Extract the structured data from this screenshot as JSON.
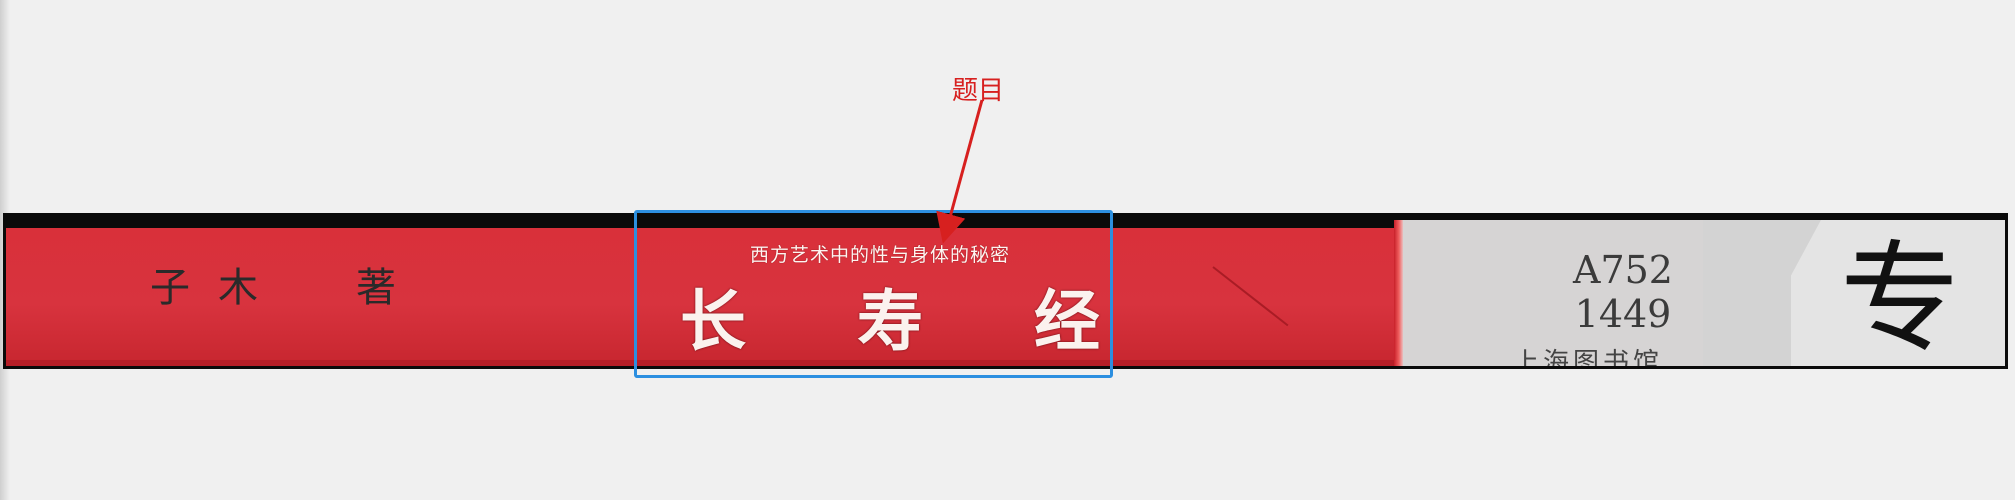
{
  "annotation": {
    "label": "题目",
    "color": "#d7201f",
    "box_color": "#2c8fe0"
  },
  "spine": {
    "background": "#d8333e",
    "author": {
      "char1": "子",
      "char2": "木",
      "char3": "著"
    },
    "subtitle": "西方艺术中的性与身体的秘密",
    "title": {
      "char1": "长",
      "char2": "寿",
      "char3": "经"
    }
  },
  "label": {
    "call_number_line1": "A752",
    "call_number_line2": "1449",
    "library_name": "上海图书馆",
    "special_char": "专"
  }
}
